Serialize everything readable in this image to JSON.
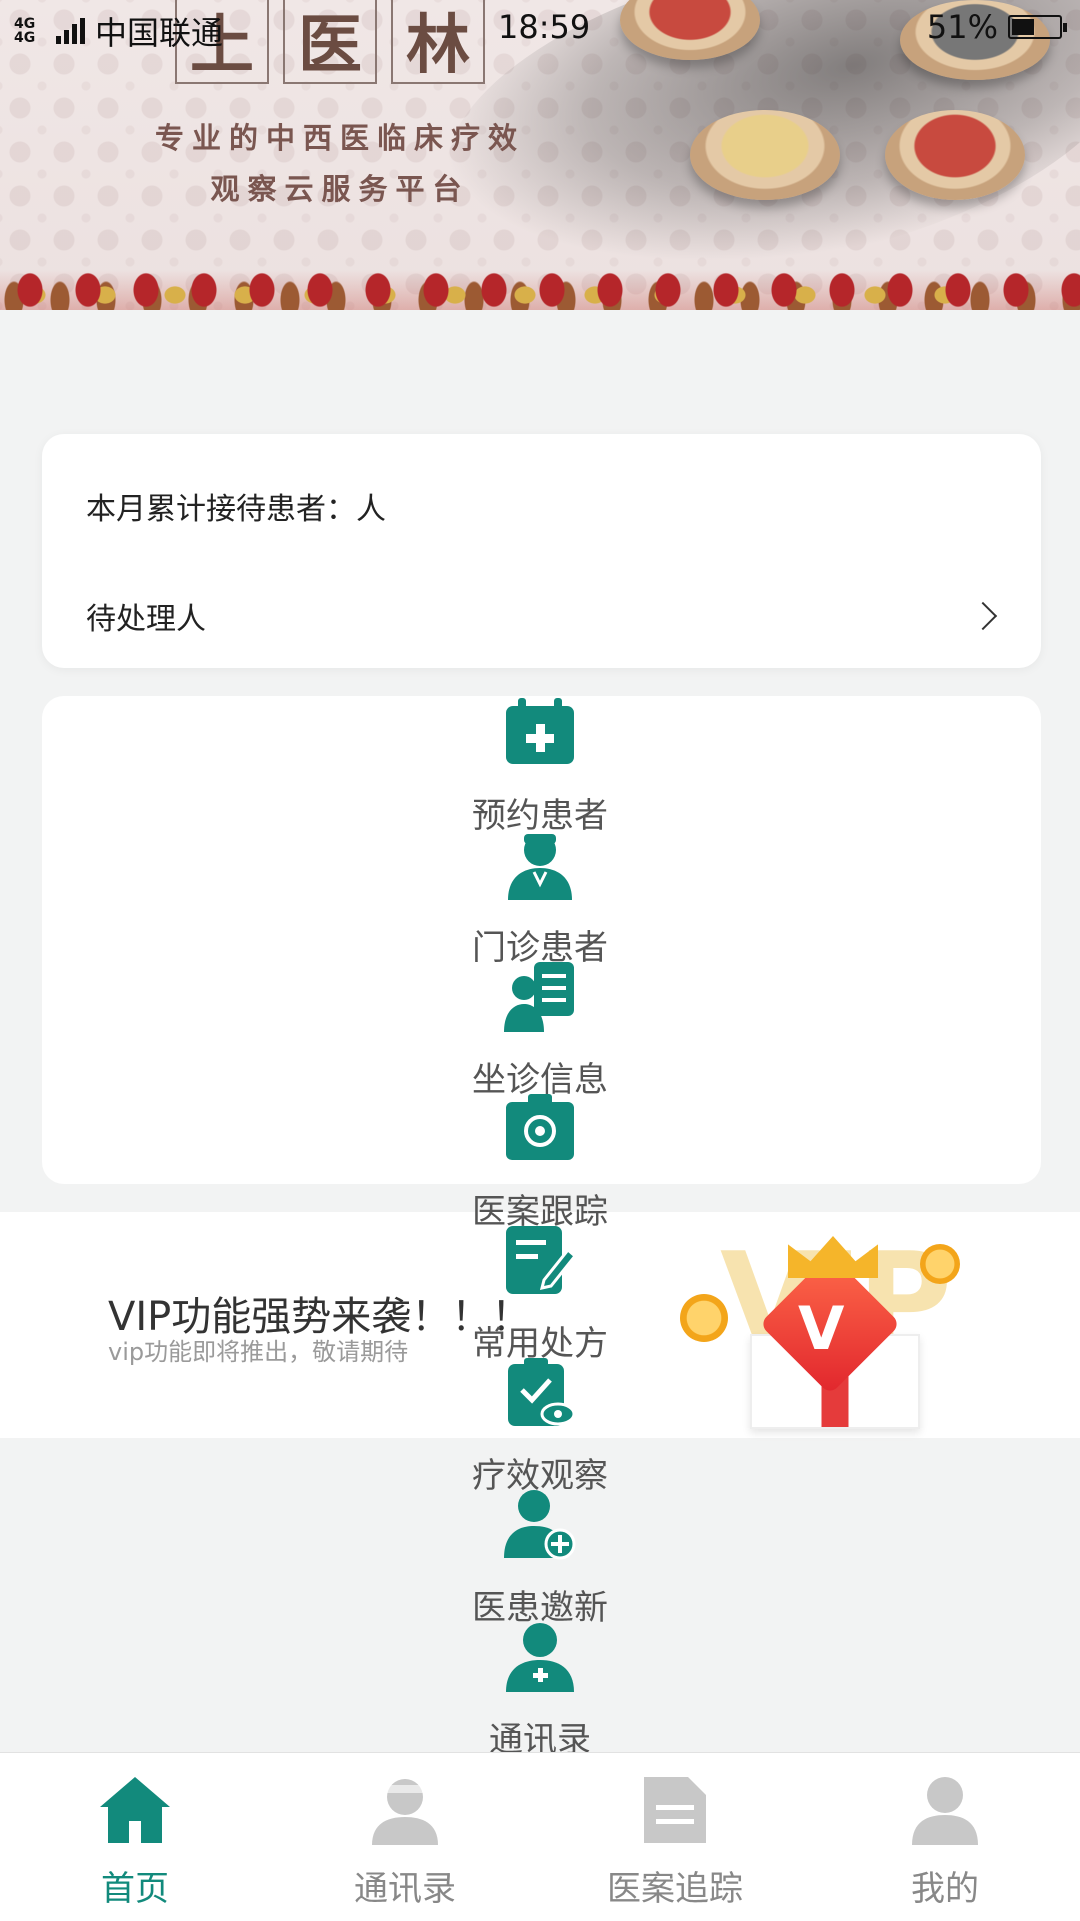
{
  "status_bar": {
    "network": "4G 4G",
    "carrier": "中国联通",
    "time": "18:59",
    "battery": "51%"
  },
  "banner": {
    "logo_chars": [
      "上",
      "医",
      "林"
    ],
    "slogan_line1": "专业的中西医临床疗效",
    "slogan_line2": "观察云服务平台"
  },
  "stats": {
    "monthly_patients": "本月累计接待患者：人",
    "pending": "待处理人"
  },
  "menu": {
    "items": [
      {
        "label": "预约患者",
        "icon": "calendar-medical-icon"
      },
      {
        "label": "门诊患者",
        "icon": "nurse-icon"
      },
      {
        "label": "坐诊信息",
        "icon": "doctor-list-icon"
      },
      {
        "label": "医案跟踪",
        "icon": "case-track-icon"
      },
      {
        "label": "常用处方",
        "icon": "prescription-edit-icon"
      },
      {
        "label": "疗效观察",
        "icon": "clipboard-observe-icon"
      },
      {
        "label": "医患邀新",
        "icon": "add-user-icon"
      },
      {
        "label": "通讯录",
        "icon": "contacts-icon"
      }
    ]
  },
  "vip": {
    "title": "VIP功能强势来袭！！！",
    "subtitle": "vip功能即将推出，敬请期待",
    "art_text": "VIP"
  },
  "tabbar": {
    "tabs": [
      {
        "label": "首页",
        "icon": "home-icon",
        "active": true
      },
      {
        "label": "通讯录",
        "icon": "contacts-tab-icon",
        "active": false
      },
      {
        "label": "医案追踪",
        "icon": "case-file-icon",
        "active": false
      },
      {
        "label": "我的",
        "icon": "profile-icon",
        "active": false
      }
    ]
  },
  "colors": {
    "accent": "#128a7c",
    "background": "#f2f3f3",
    "tab_inactive": "#c8c8c8"
  }
}
